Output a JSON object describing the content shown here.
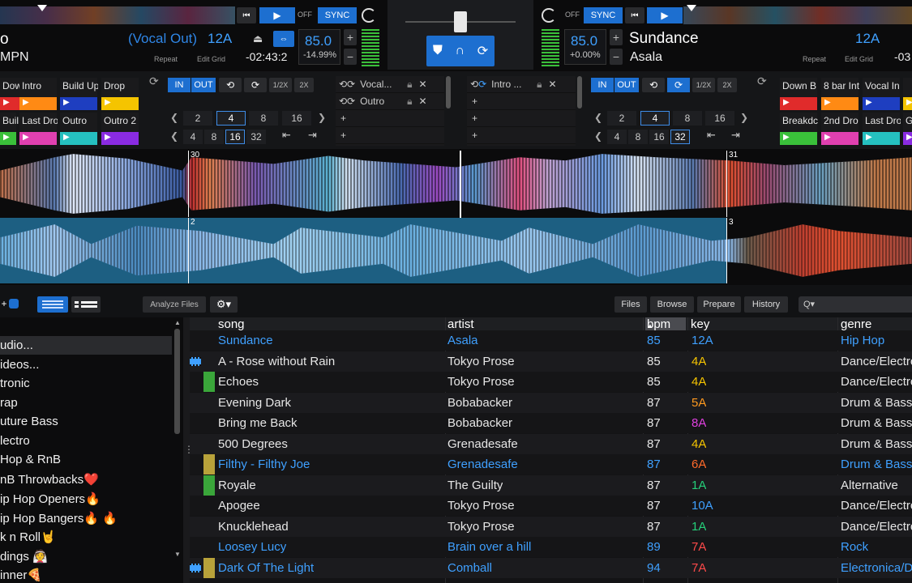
{
  "deck_left": {
    "title_partial": "o",
    "artist_partial": "MPN",
    "vocal_cue": "(Vocal Out)",
    "key": "12A",
    "bpm": "85.0",
    "pitch": "-14.99%",
    "time": "-02:43:2",
    "repeat_label": "Repeat",
    "edit_grid_label": "Edit Grid",
    "off_label": "OFF",
    "sync_label": "SYNC",
    "cues_row1": [
      "Down B",
      "Intro",
      "Build Up",
      "Drop"
    ],
    "cues_row2": [
      "Buil",
      "Last Dro",
      "Outro",
      "Outro 2"
    ],
    "loop_in": "IN",
    "loop_out": "OUT",
    "half": "1/2X",
    "double": "2X",
    "loop_sizes_a": [
      "2",
      "4",
      "8",
      "16"
    ],
    "loop_sizes_b": [
      "4",
      "8",
      "16",
      "32"
    ],
    "saved_loops": [
      "Vocal...",
      "Outro"
    ],
    "waveform_marker": "30",
    "lower_marker": "2"
  },
  "deck_right": {
    "title": "Sundance",
    "artist": "Asala",
    "key": "12A",
    "bpm": "85.0",
    "pitch": "+0.00%",
    "time": "-03",
    "repeat_label": "Repeat",
    "edit_grid_label": "Edit Grid",
    "off_label": "OFF",
    "sync_label": "SYNC",
    "cues_row1": [
      "Down B",
      "8 bar Int",
      "Vocal In",
      ""
    ],
    "cues_row2": [
      "Breakdc",
      "2nd Dro",
      "Last Dro",
      "G"
    ],
    "loop_in": "IN",
    "loop_out": "OUT",
    "half": "1/2X",
    "double": "2X",
    "loop_sizes_a": [
      "2",
      "4",
      "8",
      "16"
    ],
    "loop_sizes_b": [
      "4",
      "8",
      "16",
      "32"
    ],
    "saved_loops": [
      "Intro ..."
    ],
    "waveform_marker": "31",
    "lower_marker": "3"
  },
  "browser": {
    "analyze_label": "Analyze Files",
    "tabs": [
      "Files",
      "Browse",
      "Prepare",
      "History"
    ],
    "search_placeholder": "Q▾"
  },
  "sidebar": {
    "items": [
      "udio...",
      "ideos...",
      "tronic",
      "rap",
      "uture Bass",
      "lectro",
      "Hop & RnB",
      "nB Throwbacks❤️",
      "ip Hop Openers🔥",
      "ip Hop Bangers🔥 🔥",
      "k n Roll🤘",
      "dings 👰",
      "inner🍕"
    ]
  },
  "table": {
    "columns": [
      "song",
      "artist",
      "bpm",
      "key",
      "genre"
    ],
    "rows": [
      {
        "song": "Sundance",
        "artist": "Asala",
        "bpm": "85",
        "key": "12A",
        "genre": "Hip Hop",
        "hl": true,
        "key_color": "#3fa0ff",
        "swatch": ""
      },
      {
        "song": "A - Rose without Rain",
        "artist": "Tokyo Prose",
        "bpm": "85",
        "key": "4A",
        "genre": "Dance/Electro",
        "hl": false,
        "key_color": "#f5c400",
        "swatch": "video"
      },
      {
        "song": "Echoes",
        "artist": "Tokyo Prose",
        "bpm": "85",
        "key": "4A",
        "genre": "Dance/Electro",
        "hl": false,
        "key_color": "#f5c400",
        "swatch": "#3aa63a"
      },
      {
        "song": "Evening Dark",
        "artist": "Bobabacker",
        "bpm": "87",
        "key": "5A",
        "genre": "Drum & Bass",
        "hl": false,
        "key_color": "#ff9a1f",
        "swatch": ""
      },
      {
        "song": "Bring me Back",
        "artist": "Bobabacker",
        "bpm": "87",
        "key": "8A",
        "genre": "Drum & Bass",
        "hl": false,
        "key_color": "#e040e0",
        "swatch": ""
      },
      {
        "song": "500 Degrees",
        "artist": "Grenadesafe",
        "bpm": "87",
        "key": "4A",
        "genre": "Drum & Bass",
        "hl": false,
        "key_color": "#f5c400",
        "swatch": ""
      },
      {
        "song": "Filthy - Filthy Joe",
        "artist": "Grenadesafe",
        "bpm": "87",
        "key": "6A",
        "genre": "Drum & Bass",
        "hl": true,
        "key_color": "#ff6a2a",
        "swatch": "#b8a23a"
      },
      {
        "song": "Royale",
        "artist": "The Guilty",
        "bpm": "87",
        "key": "1A",
        "genre": "Alternative",
        "hl": false,
        "key_color": "#25d07a",
        "swatch": "#3aa63a"
      },
      {
        "song": "Apogee",
        "artist": "Tokyo Prose",
        "bpm": "87",
        "key": "10A",
        "genre": "Dance/Electro",
        "hl": false,
        "key_color": "#3fa0ff",
        "swatch": ""
      },
      {
        "song": "Knucklehead",
        "artist": "Tokyo Prose",
        "bpm": "87",
        "key": "1A",
        "genre": "Dance/Electro",
        "hl": false,
        "key_color": "#25d07a",
        "swatch": ""
      },
      {
        "song": "Loosey Lucy",
        "artist": "Brain over a hill",
        "bpm": "89",
        "key": "7A",
        "genre": "Rock",
        "hl": true,
        "key_color": "#ff4a4a",
        "swatch": ""
      },
      {
        "song": "Dark Of The Light",
        "artist": "Comball",
        "bpm": "94",
        "key": "7A",
        "genre": "Electronica/D",
        "hl": true,
        "key_color": "#ff4a4a",
        "swatch": "video"
      }
    ]
  },
  "colors": {
    "accent": "#1d6fd0",
    "highlight_text": "#3fa0ff"
  }
}
